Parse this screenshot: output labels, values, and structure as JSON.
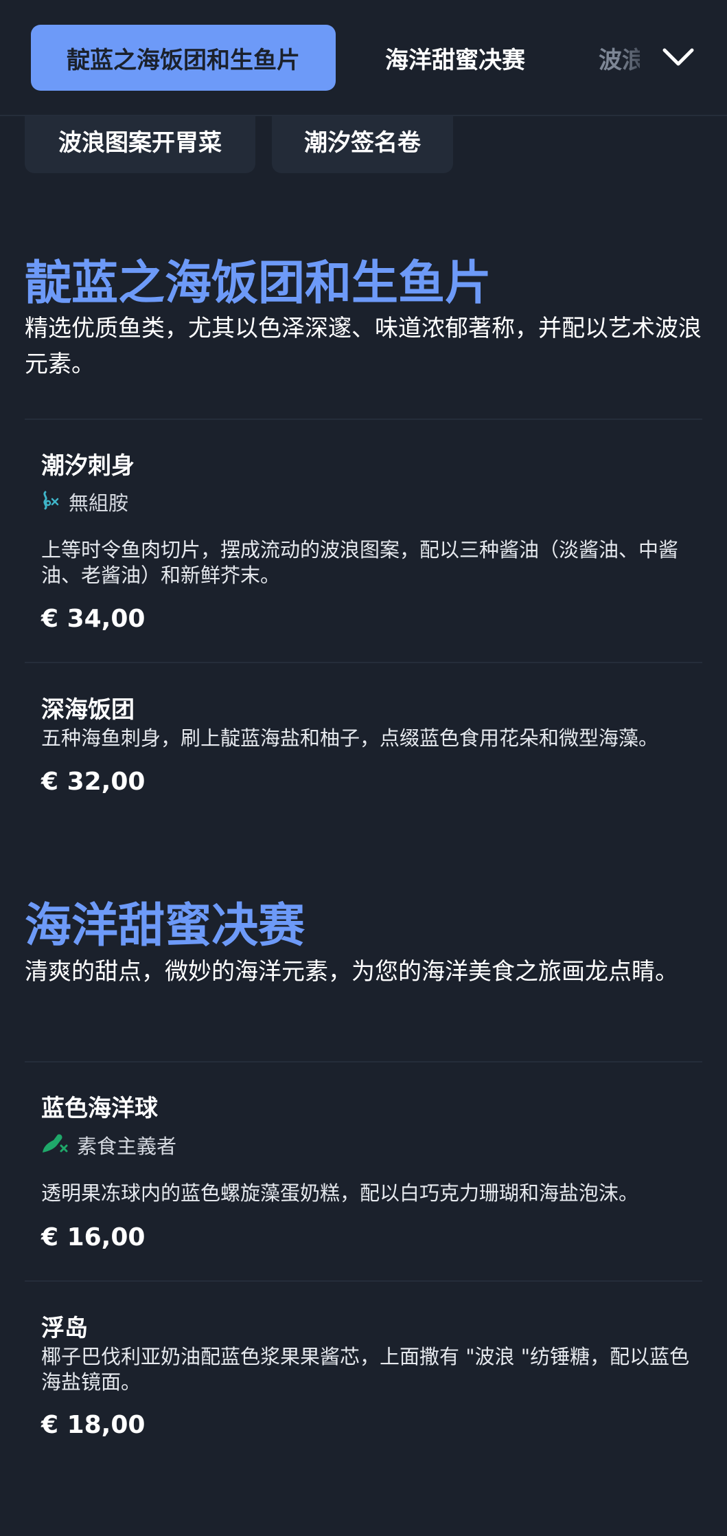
{
  "nav": {
    "tabs": [
      {
        "label": "靛蓝之海饭团和生鱼片",
        "active": true
      },
      {
        "label": "海洋甜蜜决赛",
        "active": false
      },
      {
        "label": "波浪",
        "active": false
      }
    ],
    "expand_icon": "chevron-down-icon"
  },
  "subnav": {
    "chips": [
      "波浪图案开胃菜",
      "潮汐签名卷"
    ]
  },
  "sections": [
    {
      "title": "靛蓝之海饭团和生鱼片",
      "description": "精选优质鱼类，尤其以色泽深邃、味道浓郁著称，并配以艺术波浪元素。",
      "items": [
        {
          "name": "潮汐刺身",
          "tag": {
            "icon": "histamine-free-icon",
            "label": "無組胺"
          },
          "description": "上等时令鱼肉切片，摆成流动的波浪图案，配以三种酱油（淡酱油、中酱油、老酱油）和新鲜芥末。",
          "price": "€ 34,00"
        },
        {
          "name": "深海饭团",
          "description": "五种海鱼刺身，刷上靛蓝海盐和柚子，点缀蓝色食用花朵和微型海藻。",
          "price": "€ 32,00"
        }
      ]
    },
    {
      "title": "海洋甜蜜决赛",
      "description": "清爽的甜点，微妙的海洋元素，为您的海洋美食之旅画龙点睛。",
      "items": [
        {
          "name": "蓝色海洋球",
          "tag": {
            "icon": "vegetarian-icon",
            "label": "素食主義者"
          },
          "description": "透明果冻球内的蓝色螺旋藻蛋奶糕，配以白巧克力珊瑚和海盐泡沫。",
          "price": "€ 16,00"
        },
        {
          "name": "浮岛",
          "description": "椰子巴伐利亚奶油配蓝色浆果果酱芯，上面撒有 \"波浪 \"纺锤糖，配以蓝色海盐镜面。",
          "price": "€ 18,00"
        }
      ]
    }
  ],
  "colors": {
    "background": "#1b212c",
    "accent": "#6d9af8",
    "chip": "#232b38",
    "tag_histamine": "#3fb5c9",
    "tag_vegan": "#1fa86a"
  }
}
